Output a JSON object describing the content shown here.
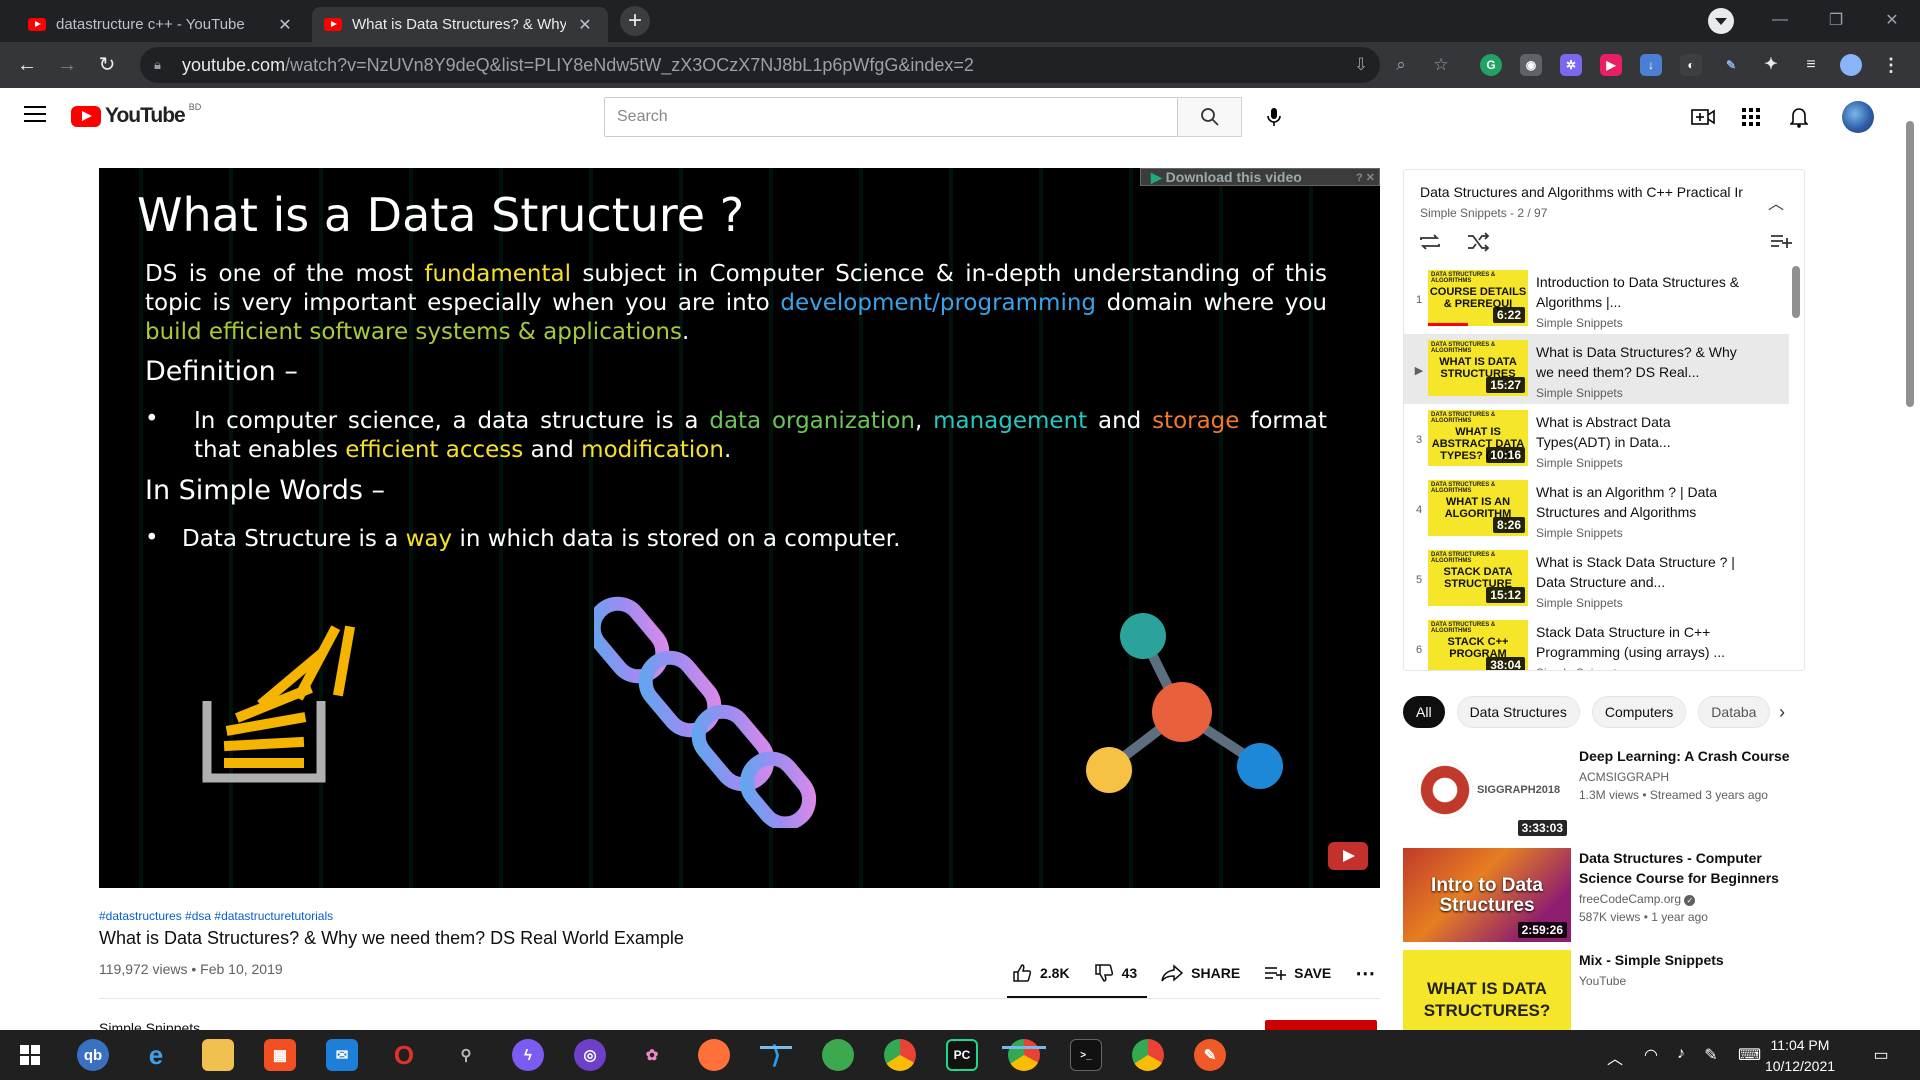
{
  "browser": {
    "tabs": [
      {
        "title": "datastructure c++ - YouTube",
        "active": false
      },
      {
        "title": "What is Data Structures? & Why",
        "active": true
      }
    ],
    "newtab_label": "+",
    "url_host": "youtube.com",
    "url_rest": "/watch?v=NzUVn8Y9deQ&list=PLIY8eNdw5tW_zX3OCzX7NJ8bL1p6pWfgG&index=2"
  },
  "youtube": {
    "logo_text": "YouTube",
    "country_code": "BD",
    "search_placeholder": "Search"
  },
  "player": {
    "download_bar": "Download this video",
    "slide": {
      "title": "What is a Data Structure ?",
      "intro_1": "DS is one of the most ",
      "intro_hl_1": "fundamental",
      "intro_2": " subject in Computer Science & in-depth understanding of this topic is very important especially when you are into ",
      "intro_hl_2": "development/programming",
      "intro_3": " domain where you ",
      "intro_hl_3": "build efficient software systems & applications",
      "intro_4": ".",
      "definition_heading": "Definition –",
      "def_1": "In computer science, a data structure is a ",
      "def_hl_1": "data organization",
      "def_2": ", ",
      "def_hl_2": "management",
      "def_3": " and ",
      "def_hl_3": "storage",
      "def_4": " format that enables ",
      "def_hl_4": "efficient access",
      "def_5": " and ",
      "def_hl_5": "modification",
      "def_6": ".",
      "simple_heading": "In Simple Words –",
      "simple_1": "Data Structure is a ",
      "simple_hl_1": "way",
      "simple_2": " in which data is stored on a computer."
    }
  },
  "video": {
    "hashtags": "#datastructures #dsa #datastructuretutorials",
    "title": "What is Data Structures? & Why we need them? DS Real World Example",
    "meta": "119,972 views • Feb 10, 2019",
    "likes": "2.8K",
    "dislikes": "43",
    "share_label": "SHARE",
    "save_label": "SAVE",
    "channel_peek": "Simple Snippets"
  },
  "playlist": {
    "title": "Data Structures and Algorithms with C++ Practical Ir",
    "subtitle": "Simple Snippets - 2 / 97",
    "items": [
      {
        "index": "1",
        "title": "Introduction to Data Structures & Algorithms |...",
        "channel": "Simple Snippets",
        "duration": "6:22",
        "thumb_text": "COURSE DETAILS & PREREQUI",
        "current": false,
        "watched": 0.4
      },
      {
        "index": "▶",
        "title": "What is Data Structures? & Why we need them? DS Real...",
        "channel": "Simple Snippets",
        "duration": "15:27",
        "thumb_text": "WHAT IS DATA STRUCTURES",
        "current": true
      },
      {
        "index": "3",
        "title": "What is Abstract Data Types(ADT) in Data...",
        "channel": "Simple Snippets",
        "duration": "10:16",
        "thumb_text": "WHAT IS ABSTRACT DATA TYPES? (ADT)",
        "current": false
      },
      {
        "index": "4",
        "title": "What is an Algorithm ? | Data Structures and Algorithms",
        "channel": "Simple Snippets",
        "duration": "8:26",
        "thumb_text": "WHAT IS AN ALGORITHM",
        "current": false
      },
      {
        "index": "5",
        "title": "What is Stack Data Structure ? | Data Structure and...",
        "channel": "Simple Snippets",
        "duration": "15:12",
        "thumb_text": "STACK DATA STRUCTURE",
        "current": false
      },
      {
        "index": "6",
        "title": "Stack Data Structure in C++ Programming (using arrays) ...",
        "channel": "Simple Snippets",
        "duration": "38:04",
        "thumb_text": "STACK C++ PROGRAM",
        "current": false
      }
    ]
  },
  "chips": [
    "All",
    "Data Structures",
    "Computers",
    "Databa"
  ],
  "recommendations": [
    {
      "title": "Deep Learning: A Crash Course",
      "channel": "ACMSIGGRAPH",
      "meta": "1.3M views • Streamed 3 years ago",
      "duration": "3:33:03",
      "thumb_text": "SIGGRAPH2018"
    },
    {
      "title": "Data Structures - Computer Science Course for Beginners",
      "channel": "freeCodeCamp.org",
      "meta": "587K views • 1 year ago",
      "duration": "2:59:26",
      "thumb_text": "Intro to Data Structures"
    },
    {
      "title": "Mix - Simple Snippets",
      "channel": "YouTube",
      "meta": "",
      "duration": "",
      "thumb_text": "WHAT IS DATA STRUCTURES?"
    }
  ],
  "taskbar": {
    "time": "11:04 PM",
    "date": "10/12/2021"
  },
  "colors": {
    "youtube_red": "#ff0000",
    "slide_yellow": "#f5e02a",
    "slide_blue": "#3aa3e8",
    "slide_green": "#6cc35b",
    "slide_orange": "#f07a2c"
  }
}
